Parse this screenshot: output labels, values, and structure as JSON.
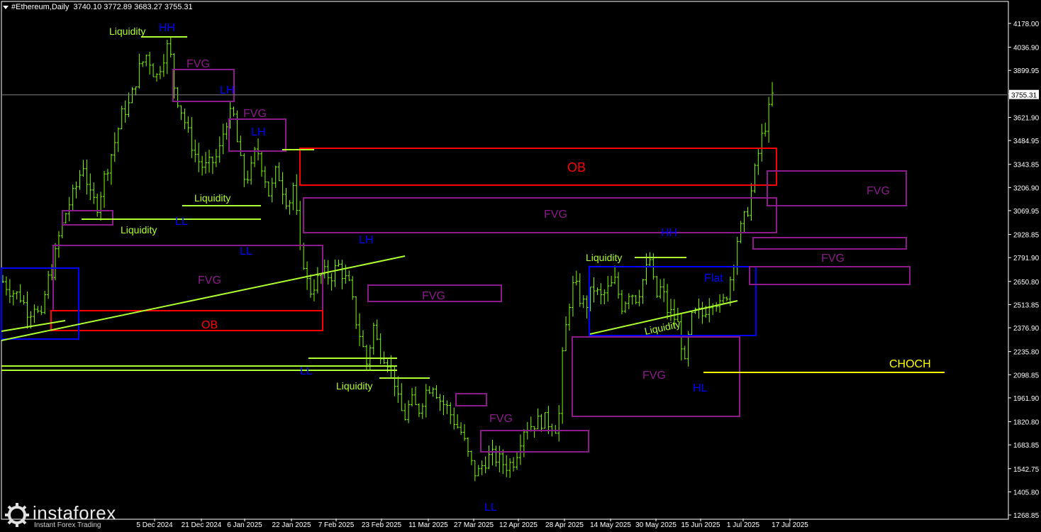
{
  "header": {
    "symbol": "#Ethereum,Daily",
    "ohlc": "3740.10 3772.89 3683.27 3755.31"
  },
  "watermark": {
    "brand": "instaforex",
    "tagline": "Instant Forex Trading"
  },
  "colors": {
    "background": "#000000",
    "candle": "#7CFC00",
    "liquidity": "#ADFF2F",
    "fvg": "#8B1A8B",
    "ob": "#FF0000",
    "structure": "#0000FF",
    "choch": "#FFFF00",
    "axis_text": "#FFFFFF",
    "price_line": "#808080"
  },
  "chart_data": {
    "type": "candlestick",
    "title": "#Ethereum,Daily",
    "current_price": 3755.31,
    "current_price_label": "3755.31",
    "ylim": [
      1200,
      4310
    ],
    "y_ticks": [
      4178.0,
      4036.9,
      3899.95,
      3761.0,
      3621.9,
      3484.95,
      3343.85,
      3206.9,
      3069.95,
      2928.85,
      2791.9,
      2650.8,
      2513.85,
      2376.9,
      2235.8,
      2098.85,
      1961.9,
      1820.8,
      1683.85,
      1542.75,
      1405.8,
      1268.85
    ],
    "y_tick_labels": [
      "4178.00",
      "4036.90",
      "3899.95",
      "",
      "3621.90",
      "3484.95",
      "3343.85",
      "3206.90",
      "3069.95",
      "2928.85",
      "2791.90",
      "2650.80",
      "2513.85",
      "2376.90",
      "2235.80",
      "2098.85",
      "1961.90",
      "1820.80",
      "1683.85",
      "1542.75",
      "1405.80",
      "1268.85"
    ],
    "x_tick_labels": [
      "5 Dec 2024",
      "21 Dec 2024",
      "6 Jan 2025",
      "22 Jan 2025",
      "7 Feb 2025",
      "23 Feb 2025",
      "11 Mar 2025",
      "27 Mar 2025",
      "12 Apr 2025",
      "28 Apr 2025",
      "14 May 2025",
      "30 May 2025",
      "15 Jun 2025",
      "1 Jul 2025",
      "17 Jul 2025"
    ],
    "price_path": [
      [
        0.0,
        2650
      ],
      [
        0.5,
        2600
      ],
      [
        1.2,
        2560
      ],
      [
        1.8,
        2460
      ],
      [
        2.2,
        2520
      ],
      [
        2.6,
        2400
      ],
      [
        3.0,
        2640
      ],
      [
        3.4,
        2720
      ],
      [
        3.8,
        2900
      ],
      [
        4.4,
        3080
      ],
      [
        5.0,
        3200
      ],
      [
        5.5,
        3350
      ],
      [
        6.0,
        3150
      ],
      [
        6.5,
        3100
      ],
      [
        7.0,
        3280
      ],
      [
        7.6,
        3450
      ],
      [
        8.2,
        3650
      ],
      [
        8.7,
        3700
      ],
      [
        9.3,
        3900
      ],
      [
        9.9,
        4000
      ],
      [
        10.5,
        3850
      ],
      [
        11.0,
        3980
      ],
      [
        11.4,
        4060
      ],
      [
        11.8,
        3780
      ],
      [
        12.3,
        3650
      ],
      [
        12.8,
        3500
      ],
      [
        13.3,
        3380
      ],
      [
        13.8,
        3320
      ],
      [
        14.3,
        3350
      ],
      [
        14.8,
        3400
      ],
      [
        15.3,
        3600
      ],
      [
        15.8,
        3650
      ],
      [
        16.2,
        3400
      ],
      [
        16.6,
        3250
      ],
      [
        17.0,
        3300
      ],
      [
        17.4,
        3450
      ],
      [
        17.9,
        3300
      ],
      [
        18.3,
        3150
      ],
      [
        18.8,
        3320
      ],
      [
        19.2,
        3200
      ],
      [
        19.6,
        3100
      ],
      [
        20.0,
        3250
      ],
      [
        20.3,
        2850
      ],
      [
        20.7,
        2750
      ],
      [
        21.0,
        2580
      ],
      [
        21.5,
        2650
      ],
      [
        22.0,
        2700
      ],
      [
        22.5,
        2680
      ],
      [
        23.0,
        2750
      ],
      [
        23.4,
        2680
      ],
      [
        23.8,
        2620
      ],
      [
        24.2,
        2430
      ],
      [
        24.6,
        2300
      ],
      [
        25.0,
        2150
      ],
      [
        25.4,
        2400
      ],
      [
        25.8,
        2250
      ],
      [
        26.3,
        2200
      ],
      [
        26.8,
        2100
      ],
      [
        27.2,
        1900
      ],
      [
        27.6,
        1850
      ],
      [
        28.0,
        1950
      ],
      [
        28.5,
        1880
      ],
      [
        29.0,
        2000
      ],
      [
        29.5,
        2050
      ],
      [
        30.0,
        1950
      ],
      [
        30.5,
        1900
      ],
      [
        31.0,
        1820
      ],
      [
        31.5,
        1750
      ],
      [
        32.0,
        1600
      ],
      [
        32.5,
        1500
      ],
      [
        33.0,
        1580
      ],
      [
        33.5,
        1620
      ],
      [
        34.0,
        1600
      ],
      [
        34.5,
        1560
      ],
      [
        35.0,
        1580
      ],
      [
        35.3,
        1650
      ],
      [
        35.7,
        1780
      ],
      [
        36.2,
        1800
      ],
      [
        36.7,
        1820
      ],
      [
        37.2,
        1830
      ],
      [
        37.7,
        1800
      ],
      [
        38.1,
        1780
      ],
      [
        38.4,
        2200
      ],
      [
        38.8,
        2500
      ],
      [
        39.2,
        2650
      ],
      [
        39.6,
        2550
      ],
      [
        40.0,
        2500
      ],
      [
        40.5,
        2620
      ],
      [
        41.0,
        2550
      ],
      [
        41.5,
        2600
      ],
      [
        42.0,
        2650
      ],
      [
        42.5,
        2500
      ],
      [
        43.0,
        2600
      ],
      [
        43.5,
        2550
      ],
      [
        44.0,
        2680
      ],
      [
        44.4,
        2780
      ],
      [
        44.8,
        2550
      ],
      [
        45.2,
        2620
      ],
      [
        45.6,
        2480
      ],
      [
        46.0,
        2450
      ],
      [
        46.4,
        2380
      ],
      [
        46.8,
        2150
      ],
      [
        47.2,
        2420
      ],
      [
        47.6,
        2470
      ],
      [
        48.0,
        2450
      ],
      [
        48.4,
        2520
      ],
      [
        48.8,
        2560
      ],
      [
        49.2,
        2500
      ],
      [
        49.6,
        2550
      ],
      [
        50.0,
        2700
      ],
      [
        50.4,
        2900
      ],
      [
        50.8,
        3000
      ],
      [
        51.2,
        3100
      ],
      [
        51.6,
        3300
      ],
      [
        52.0,
        3480
      ],
      [
        52.4,
        3600
      ],
      [
        52.8,
        3750
      ],
      [
        53.0,
        3755
      ]
    ],
    "annotations": [
      {
        "kind": "label",
        "text": "Liquidity",
        "color": "liquidity"
      },
      {
        "kind": "label",
        "text": "HH",
        "color": "structure"
      },
      {
        "kind": "label",
        "text": "FVG",
        "color": "fvg"
      },
      {
        "kind": "label",
        "text": "LH",
        "color": "structure"
      },
      {
        "kind": "label",
        "text": "FVG",
        "color": "fvg"
      },
      {
        "kind": "label",
        "text": "LH",
        "color": "structure"
      },
      {
        "kind": "label",
        "text": "Liquidity",
        "color": "liquidity"
      },
      {
        "kind": "label",
        "text": "LL",
        "color": "structure"
      },
      {
        "kind": "label",
        "text": "Liquidity",
        "color": "liquidity"
      },
      {
        "kind": "label",
        "text": "LL",
        "color": "structure"
      },
      {
        "kind": "label",
        "text": "FVG",
        "color": "fvg"
      },
      {
        "kind": "label",
        "text": "OB",
        "color": "ob"
      },
      {
        "kind": "label",
        "text": "OB",
        "color": "ob"
      },
      {
        "kind": "label",
        "text": "FVG",
        "color": "fvg"
      },
      {
        "kind": "label",
        "text": "LH",
        "color": "structure"
      },
      {
        "kind": "label",
        "text": "FVG",
        "color": "fvg"
      },
      {
        "kind": "label",
        "text": "LL",
        "color": "structure"
      },
      {
        "kind": "label",
        "text": "Liquidity",
        "color": "liquidity"
      },
      {
        "kind": "label",
        "text": "FVG",
        "color": "fvg"
      },
      {
        "kind": "label",
        "text": "LL",
        "color": "structure"
      },
      {
        "kind": "label",
        "text": "HH",
        "color": "structure"
      },
      {
        "kind": "label",
        "text": "Liquidity",
        "color": "liquidity"
      },
      {
        "kind": "label",
        "text": "Flat",
        "color": "structure"
      },
      {
        "kind": "label",
        "text": "Liquidity",
        "color": "liquidity"
      },
      {
        "kind": "label",
        "text": "FVG",
        "color": "fvg"
      },
      {
        "kind": "label",
        "text": "HL",
        "color": "structure"
      },
      {
        "kind": "label",
        "text": "FVG",
        "color": "fvg"
      },
      {
        "kind": "label",
        "text": "FVG",
        "color": "fvg"
      },
      {
        "kind": "label",
        "text": "CHOCH",
        "color": "choch"
      }
    ]
  }
}
